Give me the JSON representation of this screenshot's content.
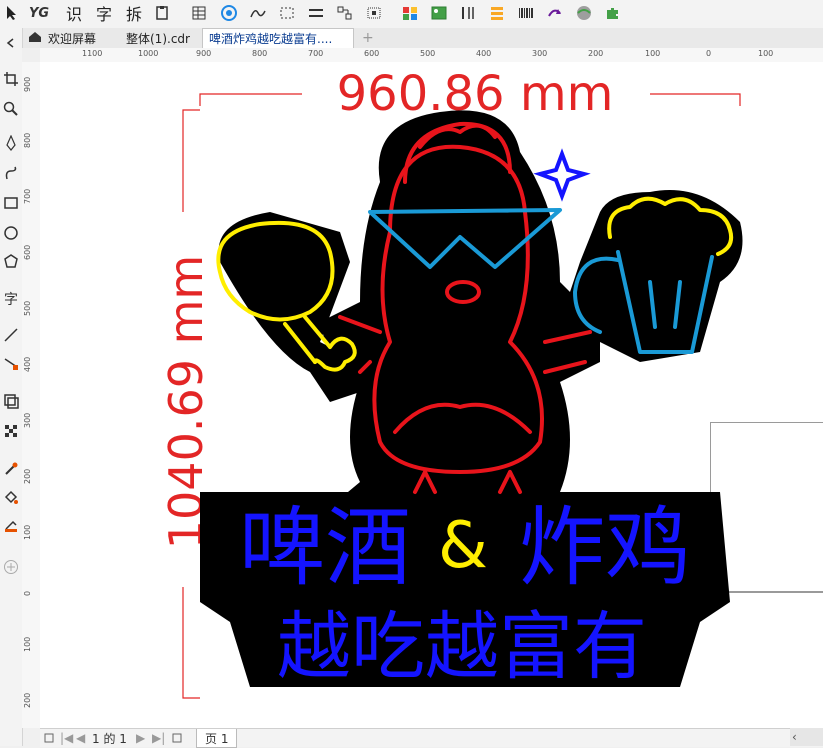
{
  "toolbar": {
    "text_buttons": [
      "识",
      "字",
      "拆"
    ],
    "logo": "YG",
    "icons": [
      "pointer-icon",
      "yg-logo-icon",
      "recognize-text-icon",
      "font-icon",
      "split-icon",
      "clipboard-icon",
      "table-icon",
      "snowflake-icon",
      "curve-icon",
      "dotted-frame-icon",
      "lines-icon",
      "nodes-icon",
      "select-grid-icon",
      "color-palette-icon",
      "image-icon",
      "text-columns-icon",
      "stack-icon",
      "barcode-icon",
      "redo-icon",
      "globe-icon",
      "puzzle-icon"
    ]
  },
  "tabs": [
    {
      "label": "欢迎屏幕"
    },
    {
      "label": "整体(1).cdr"
    },
    {
      "label": "啤酒炸鸡越吃越富有...."
    }
  ],
  "ruler": {
    "h_labels": [
      "1100",
      "1000",
      "900",
      "800",
      "700",
      "600",
      "500",
      "400",
      "300",
      "200",
      "100",
      "0",
      "100"
    ],
    "v_labels": [
      "900",
      "800",
      "700",
      "600",
      "500",
      "400",
      "300",
      "200",
      "100",
      "0",
      "100",
      "200"
    ]
  },
  "drawing": {
    "width_dimension": "960.86 mm",
    "height_dimension": "1040.69 mm",
    "line1_a": "啤酒",
    "ampersand": "&",
    "line1_b": "炸鸡",
    "line2": "越吃越富有",
    "colors": {
      "red": "#e8141b",
      "blue": "#1414ff",
      "cyan": "#1a9ad6",
      "yellow": "#ffee00",
      "black": "#000000",
      "dim": "#e32626"
    }
  },
  "statusbar": {
    "page_of": "1 的 1",
    "page_tab": "页 1"
  }
}
